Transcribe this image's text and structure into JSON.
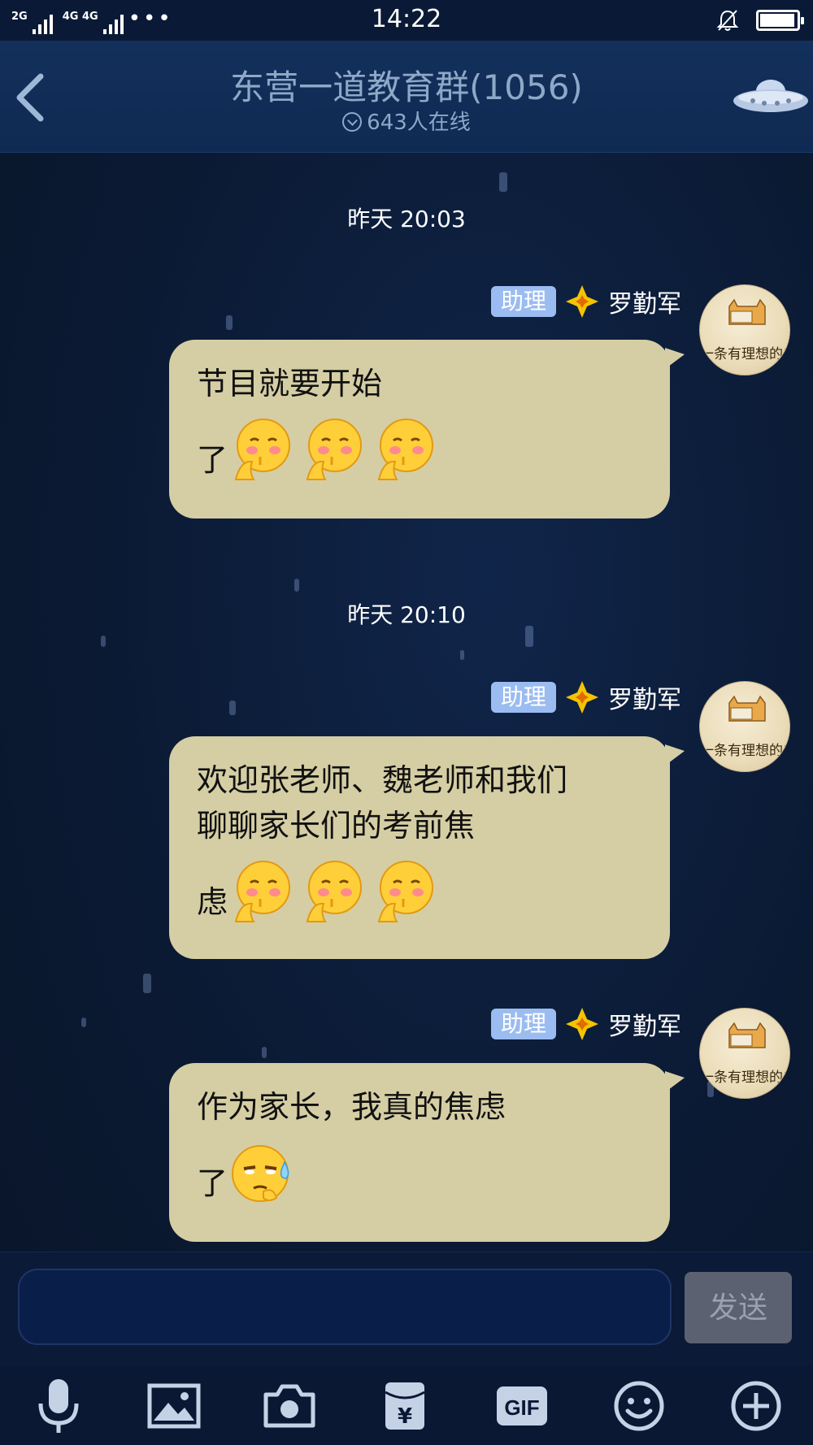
{
  "status_bar": {
    "network_1": "2G",
    "network_2": "4G 4G",
    "more": "•••",
    "time": "14:22",
    "battery_level": 0.95
  },
  "header": {
    "title": "东营一道教育群(1056)",
    "online": "643人在线"
  },
  "messages": [
    {
      "timestamp": "昨天 20:03",
      "badge": "助理",
      "sender": "罗勤军",
      "lines": [
        "节目就要开始"
      ],
      "tail_char": "了",
      "emojis": [
        "shy-emoji",
        "shy-emoji",
        "shy-emoji"
      ]
    },
    {
      "timestamp": "昨天 20:10",
      "badge": "助理",
      "sender": "罗勤军",
      "lines": [
        "欢迎张老师、魏老师和我们",
        "聊聊家长们的考前焦"
      ],
      "tail_char": "虑",
      "emojis": [
        "shy-emoji",
        "shy-emoji",
        "shy-emoji"
      ]
    },
    {
      "badge": "助理",
      "sender": "罗勤军",
      "lines": [
        "作为家长，我真的焦虑"
      ],
      "tail_char": "了",
      "emojis": [
        "sweat-emoji"
      ]
    }
  ],
  "avatar_caption": "一条有理想的咸鱼",
  "input": {
    "placeholder": "",
    "send_label": "发送"
  },
  "toolbar": {
    "items": [
      "microphone-icon",
      "image-icon",
      "camera-icon",
      "red-packet-icon",
      "gif-icon",
      "emoji-icon",
      "plus-icon"
    ],
    "red_packet_symbol": "¥",
    "gif_label": "GIF"
  },
  "colors": {
    "bubble": "#d5cea4",
    "badge": "#9bbcf0",
    "background": "#0b1a33"
  }
}
